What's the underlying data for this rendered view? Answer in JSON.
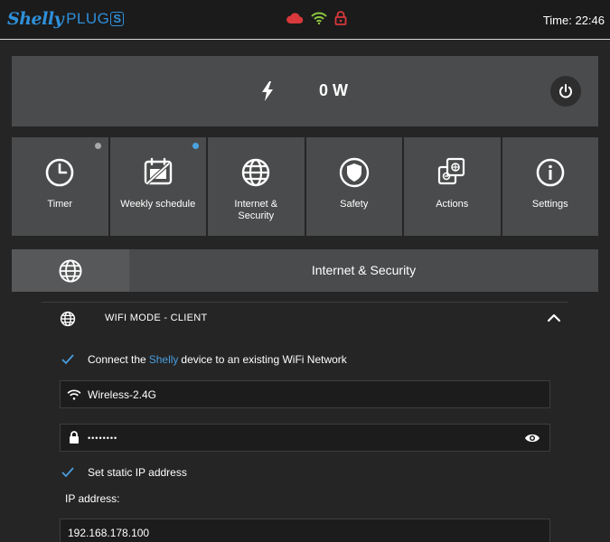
{
  "header": {
    "brand": "Shelly",
    "product": "PLUG",
    "product_badge": "S",
    "time": "Time: 22:46",
    "icons": [
      "cloud-icon",
      "wifi-icon",
      "lock-icon"
    ],
    "colors": {
      "cloud": "#d9393b",
      "wifi": "#8dc63f",
      "lock": "#d9393b"
    }
  },
  "power": {
    "value": "0 W"
  },
  "tiles": [
    {
      "label": "Timer",
      "icon": "clock-icon",
      "dot": "#a8a8a8"
    },
    {
      "label": "Weekly schedule",
      "icon": "calendar-icon",
      "dot": "#4aa3e0"
    },
    {
      "label": "Internet &\nSecurity",
      "icon": "globe-icon"
    },
    {
      "label": "Safety",
      "icon": "shield-icon"
    },
    {
      "label": "Actions",
      "icon": "actions-icon"
    },
    {
      "label": "Settings",
      "icon": "info-icon"
    }
  ],
  "section": {
    "title": "Internet & Security"
  },
  "wifi": {
    "mode_label": "WIFI MODE - CLIENT",
    "connect_text_before": "Connect the",
    "connect_text_brand": "Shelly",
    "connect_text_after": "device to an existing WiFi Network",
    "connect_checked": true,
    "ssid": "Wireless-2.4G",
    "password_mask": "••••••••",
    "static_ip_label": "Set static IP address",
    "static_ip_checked": true,
    "ip_address_label": "IP address:",
    "ip_address_value": "192.168.178.100"
  }
}
